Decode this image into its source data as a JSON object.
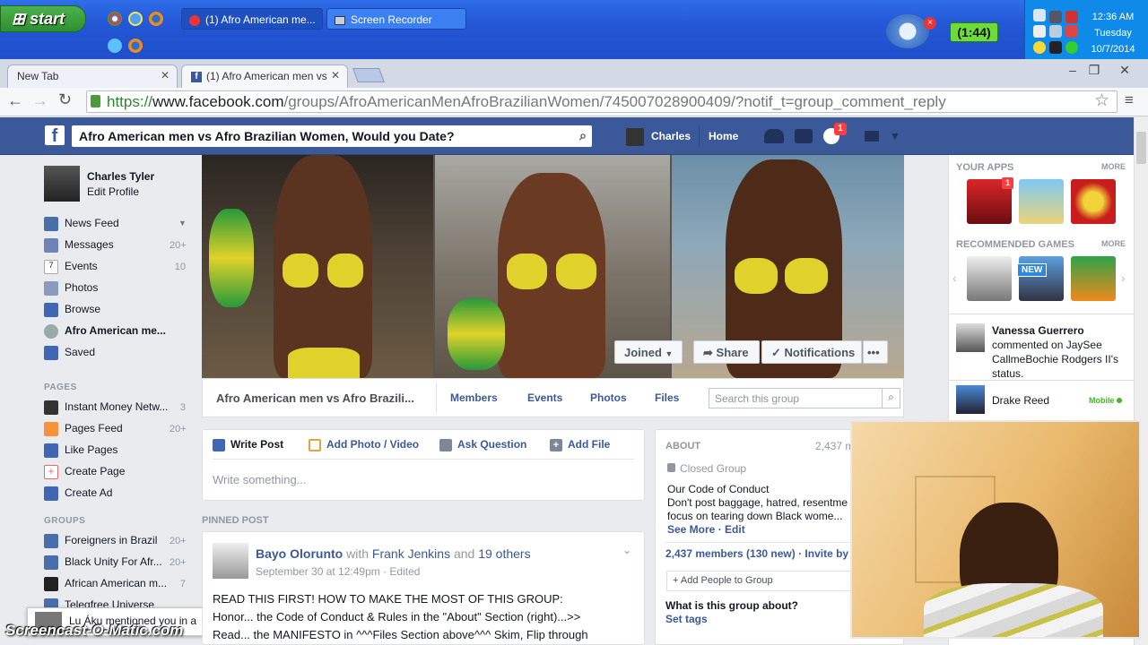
{
  "taskbar": {
    "start_label": "start",
    "tasks": [
      {
        "label": "(1) Afro American me..."
      },
      {
        "label": "Screen Recorder"
      }
    ],
    "timer": "(1:44)",
    "clock_time": "12:36 AM",
    "clock_day": "Tuesday",
    "clock_date": "10/7/2014"
  },
  "browser": {
    "tabs": [
      {
        "label": "New Tab"
      },
      {
        "label": "(1) Afro American men vs Af"
      }
    ],
    "url_scheme": "https://",
    "url_host": "www.facebook.com",
    "url_path": "/groups/AfroAmericanMenAfroBrazilianWomen/745007028900409/?notif_t=group_comment_reply"
  },
  "fbbar": {
    "search_value": "Afro American men vs  Afro Brazilian Women, Would you Date?",
    "user": "Charles",
    "home": "Home",
    "notif_count": "1"
  },
  "left": {
    "profile_name": "Charles Tyler",
    "edit_profile": "Edit Profile",
    "nav": [
      {
        "label": "News Feed",
        "count": ""
      },
      {
        "label": "Messages",
        "count": "20+"
      },
      {
        "label": "Events",
        "count": "10"
      },
      {
        "label": "Photos",
        "count": ""
      },
      {
        "label": "Browse",
        "count": ""
      },
      {
        "label": "Afro American me...",
        "count": ""
      },
      {
        "label": "Saved",
        "count": ""
      }
    ],
    "pages_heading": "PAGES",
    "pages": [
      {
        "label": "Instant Money Netw...",
        "count": "3"
      },
      {
        "label": "Pages Feed",
        "count": "20+"
      },
      {
        "label": "Like Pages",
        "count": ""
      },
      {
        "label": "Create Page",
        "count": ""
      },
      {
        "label": "Create Ad",
        "count": ""
      }
    ],
    "groups_heading": "GROUPS",
    "groups": [
      {
        "label": "Foreigners in Brazil",
        "count": "20+"
      },
      {
        "label": "Black Unity For Afr...",
        "count": "20+"
      },
      {
        "label": "African American m...",
        "count": "7"
      },
      {
        "label": "Telegfree Universe",
        "count": ""
      }
    ],
    "chat_toast": "Lu Áku mentioned you in a"
  },
  "group": {
    "joined": "Joined",
    "share": "Share",
    "notifications": "Notifications",
    "name": "Afro American men vs Afro Brazili...",
    "tabs": [
      "Members",
      "Events",
      "Photos",
      "Files"
    ],
    "search_placeholder": "Search this group"
  },
  "composer": {
    "write_post": "Write Post",
    "add_photo": "Add Photo / Video",
    "ask_question": "Ask Question",
    "add_file": "Add File",
    "placeholder": "Write something..."
  },
  "pinned": {
    "heading": "PINNED POST",
    "author": "Bayo Olorunto",
    "with_word": "with",
    "tagged": "Frank Jenkins",
    "and_word": "and",
    "others": "19 others",
    "timestamp": "September 30 at 12:49pm · Edited",
    "line1": "READ THIS FIRST! HOW TO MAKE THE MOST OF THIS GROUP:",
    "line2": "Honor... the Code of Conduct & Rules in the \"About\" Section (right)...>>",
    "line3": "Read... the MANIFESTO in ^^^Files Section above^^^ Skim, Flip through"
  },
  "about": {
    "heading": "ABOUT",
    "members_short": "2,437 m",
    "privacy": "Closed Group",
    "code_title": "Our Code of Conduct",
    "code_line1": "Don't post baggage, hatred, resentme",
    "code_line2": "focus on tearing down Black wome...",
    "see_more": "See More",
    "edit": "Edit",
    "members_line": "2,437 members (130 new)",
    "invite": "Invite by",
    "add_people": "+ Add People to Group",
    "what_about": "What is this group about?",
    "set_tags": "Set tags"
  },
  "right": {
    "apps_heading": "YOUR APPS",
    "more": "MORE",
    "apps_badge": "1",
    "games_heading": "RECOMMENDED GAMES",
    "games_more": "MORE",
    "game_new": "NEW",
    "ticker_name": "Vanessa Guerrero",
    "ticker_text1": "commented on JaySee",
    "ticker_text2": "CallmeBochie Rodgers II's",
    "ticker_text3": "status.",
    "chat_name": "Drake Reed",
    "chat_status": "Mobile"
  },
  "watermark": "Screencast-O-Matic.com"
}
